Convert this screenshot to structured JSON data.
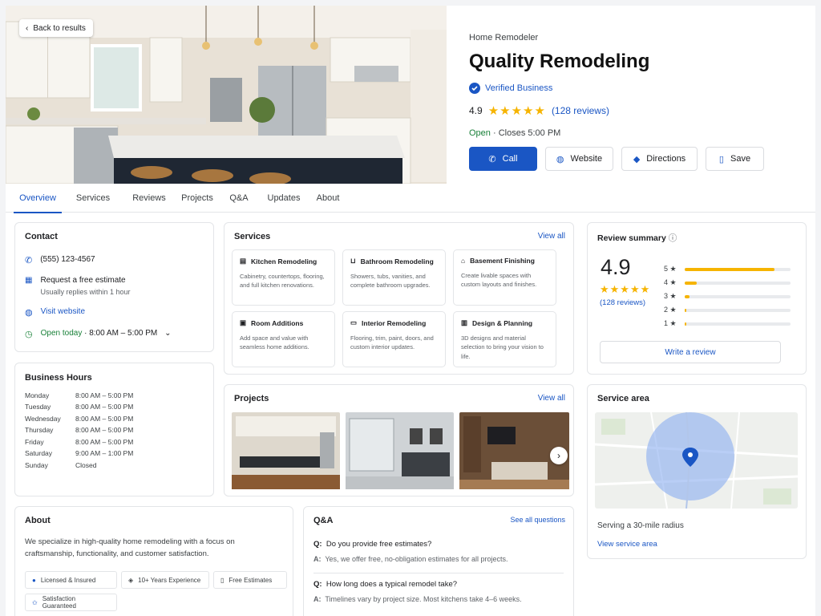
{
  "hero": {
    "back_label": "Back to results"
  },
  "business": {
    "category": "Home Remodeler",
    "name": "Quality Remodeling",
    "verified": "Verified Business",
    "rating": "4.9",
    "stars": "★★★★★",
    "reviews": "(128 reviews)",
    "open": "Open",
    "closes": "· Closes 5:00 PM"
  },
  "actions": {
    "call": "Call",
    "website": "Website",
    "directions": "Directions",
    "save": "Save"
  },
  "tabs": [
    "Overview",
    "Services",
    "Reviews",
    "Projects",
    "Q&A",
    "Updates",
    "About"
  ],
  "contact": {
    "title": "Contact",
    "phone": "(555) 123-4567",
    "estimate": "Request a free estimate",
    "estimate_sub": "Usually replies within 1 hour",
    "website": "Visit website",
    "open_today": "Open today",
    "hours": "· 8:00 AM – 5:00 PM"
  },
  "hours": {
    "title": "Business Hours",
    "rows": [
      {
        "day": "Monday",
        "time": "8:00 AM – 5:00 PM"
      },
      {
        "day": "Tuesday",
        "time": "8:00 AM – 5:00 PM"
      },
      {
        "day": "Wednesday",
        "time": "8:00 AM – 5:00 PM"
      },
      {
        "day": "Thursday",
        "time": "8:00 AM – 5:00 PM"
      },
      {
        "day": "Friday",
        "time": "8:00 AM – 5:00 PM"
      },
      {
        "day": "Saturday",
        "time": "9:00 AM – 1:00 PM"
      },
      {
        "day": "Sunday",
        "time": "Closed"
      }
    ]
  },
  "services": {
    "title": "Services",
    "view_all": "View all",
    "items": [
      {
        "name": "Kitchen Remodeling",
        "desc": "Cabinetry, countertops, flooring, and full kitchen renovations."
      },
      {
        "name": "Bathroom Remodeling",
        "desc": "Showers, tubs, vanities, and complete bathroom upgrades."
      },
      {
        "name": "Basement Finishing",
        "desc": "Create livable spaces with custom layouts and finishes."
      },
      {
        "name": "Room Additions",
        "desc": "Add space and value with seamless home additions."
      },
      {
        "name": "Interior Remodeling",
        "desc": "Flooring, trim, paint, doors, and custom interior updates."
      },
      {
        "name": "Design & Planning",
        "desc": "3D designs and material selection to bring your vision to life."
      }
    ]
  },
  "review_summary": {
    "title": "Review summary",
    "score": "4.9",
    "stars": "★★★★★",
    "count": "(128 reviews)",
    "bars": [
      {
        "label": "5 ★",
        "fraction": 0.85
      },
      {
        "label": "4 ★",
        "fraction": 0.12
      },
      {
        "label": "3 ★",
        "fraction": 0.05
      },
      {
        "label": "2 ★",
        "fraction": 0.02
      },
      {
        "label": "1 ★",
        "fraction": 0.02
      }
    ],
    "write": "Write a review"
  },
  "projects": {
    "title": "Projects",
    "view_all": "View all"
  },
  "service_area": {
    "title": "Service area",
    "radius": "Serving a 30-mile radius",
    "link": "View service area"
  },
  "about": {
    "title": "About",
    "text": "We specialize in high-quality home remodeling with a focus on craftsmanship, functionality, and customer satisfaction.",
    "badges": [
      "Licensed & Insured",
      "10+ Years Experience",
      "Free Estimates",
      "Satisfaction Guaranteed"
    ]
  },
  "qa": {
    "title": "Q&A",
    "see_all": "See all questions",
    "items": [
      {
        "q": "Do you provide free estimates?",
        "a": "Yes, we offer free, no-obligation estimates for all projects."
      },
      {
        "q": "How long does a typical remodel take?",
        "a": "Timelines vary by project size. Most kitchens take 4–6 weeks."
      }
    ]
  }
}
